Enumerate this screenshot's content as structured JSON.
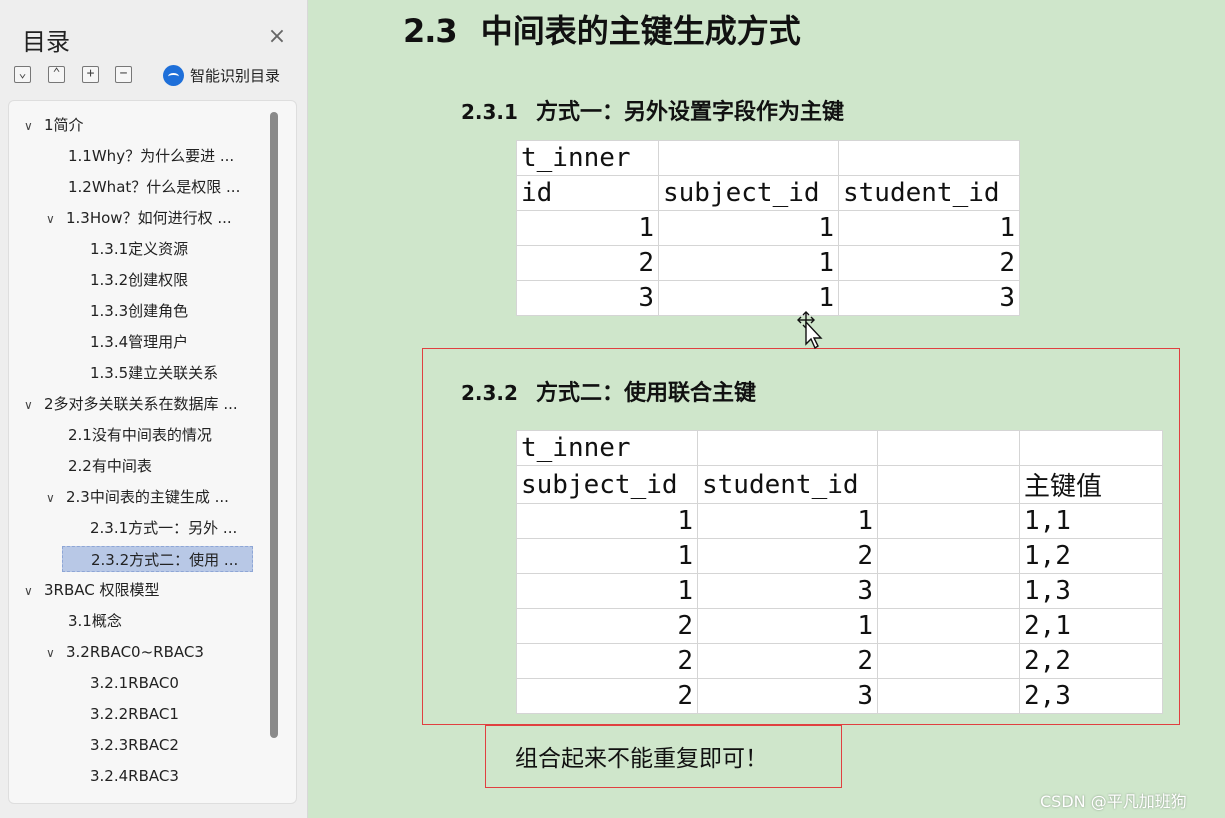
{
  "sidebar": {
    "title": "目录",
    "close_glyph": "×",
    "toolbar": {
      "collapse_glyph": "⌄",
      "expand_glyph": "⌃",
      "plus_glyph": "+",
      "minus_glyph": "−",
      "smart_label": "智能识别目录",
      "smart_icon": "cloud-icon"
    },
    "items": [
      {
        "label": "1简介",
        "arrow": "∨"
      },
      {
        "label": "1.1Why？为什么要进 ..."
      },
      {
        "label": "1.2What？什么是权限 ..."
      },
      {
        "label": "1.3How？如何进行权 ...",
        "arrow": "∨"
      },
      {
        "label": "1.3.1定义资源"
      },
      {
        "label": "1.3.2创建权限"
      },
      {
        "label": "1.3.3创建角色"
      },
      {
        "label": "1.3.4管理用户"
      },
      {
        "label": "1.3.5建立关联关系"
      },
      {
        "label": "2多对多关联关系在数据库 ...",
        "arrow": "∨"
      },
      {
        "label": "2.1没有中间表的情况"
      },
      {
        "label": "2.2有中间表"
      },
      {
        "label": "2.3中间表的主键生成 ...",
        "arrow": "∨"
      },
      {
        "label": "2.3.1方式一：另外 ..."
      },
      {
        "label": "2.3.2方式二：使用 ...",
        "selected": true
      },
      {
        "label": "3RBAC 权限模型",
        "arrow": "∨"
      },
      {
        "label": "3.1概念"
      },
      {
        "label": "3.2RBAC0~RBAC3",
        "arrow": "∨"
      },
      {
        "label": "3.2.1RBAC0"
      },
      {
        "label": "3.2.2RBAC1"
      },
      {
        "label": "3.2.3RBAC2"
      },
      {
        "label": "3.2.4RBAC3"
      }
    ]
  },
  "document": {
    "title_num": "2.3",
    "title_text": "中间表的主键生成方式",
    "section1": {
      "num": "2.3.1",
      "text": "方式一：另外设置字段作为主键",
      "table": {
        "table_name": "t_inner",
        "headers": [
          "id",
          "subject_id",
          "student_id"
        ],
        "rows": [
          [
            "1",
            "1",
            "1"
          ],
          [
            "2",
            "1",
            "2"
          ],
          [
            "3",
            "1",
            "3"
          ]
        ]
      }
    },
    "section2": {
      "num": "2.3.2",
      "text": "方式二：使用联合主键",
      "table": {
        "table_name": "t_inner",
        "headers": [
          "subject_id",
          "student_id",
          "",
          "主键值"
        ],
        "rows": [
          [
            "1",
            "1",
            "",
            "1,1"
          ],
          [
            "1",
            "2",
            "",
            "1,2"
          ],
          [
            "1",
            "3",
            "",
            "1,3"
          ],
          [
            "2",
            "1",
            "",
            "2,1"
          ],
          [
            "2",
            "2",
            "",
            "2,2"
          ],
          [
            "2",
            "3",
            "",
            "2,3"
          ]
        ]
      },
      "note": "组合起来不能重复即可！"
    }
  },
  "watermark": "CSDN @平凡加班狗",
  "colors": {
    "background": "#cfe6cb",
    "sidebar": "#eeeeee",
    "highlight_box": "#e04040",
    "selected_item": "#b8c8e6"
  }
}
